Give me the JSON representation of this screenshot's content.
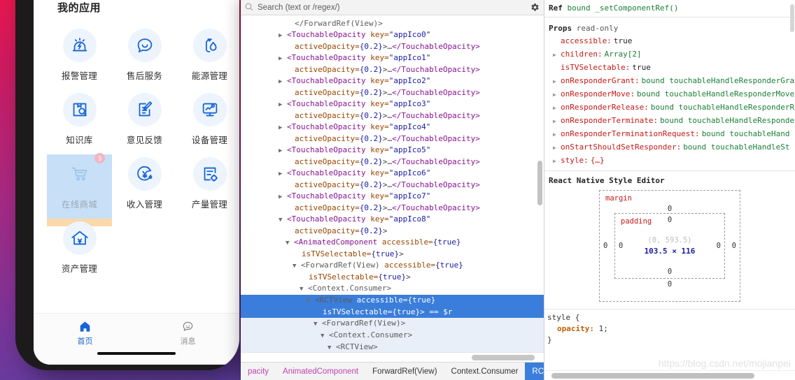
{
  "phone": {
    "section_title": "我的应用",
    "apps": [
      {
        "label": "报警管理",
        "icon": "alarm-icon",
        "selected": false,
        "badge": null
      },
      {
        "label": "售后服务",
        "icon": "chat-smile-icon",
        "selected": false,
        "badge": null
      },
      {
        "label": "能源管理",
        "icon": "energy-drop-icon",
        "selected": false,
        "badge": null
      },
      {
        "label": "知识库",
        "icon": "knowledge-search-icon",
        "selected": false,
        "badge": null
      },
      {
        "label": "意见反馈",
        "icon": "feedback-edit-icon",
        "selected": false,
        "badge": null
      },
      {
        "label": "设备管理",
        "icon": "device-monitor-icon",
        "selected": false,
        "badge": null
      },
      {
        "label": "在线商城",
        "icon": "shopping-cart-icon",
        "selected": true,
        "badge": "3"
      },
      {
        "label": "收入管理",
        "icon": "income-yuan-icon",
        "selected": false,
        "badge": null
      },
      {
        "label": "产量管理",
        "icon": "output-settings-icon",
        "selected": false,
        "badge": null
      },
      {
        "label": "资产管理",
        "icon": "asset-house-yuan-icon",
        "selected": false,
        "badge": null
      }
    ],
    "tabs": [
      {
        "label": "首页",
        "icon": "home-icon",
        "active": true
      },
      {
        "label": "消息",
        "icon": "message-icon",
        "active": false
      }
    ]
  },
  "devtools": {
    "search": {
      "placeholder": "Search (text or /regex/)",
      "value": "",
      "icon": "search-icon",
      "settings_icon": "gear-icon"
    },
    "tree_lines": [
      {
        "indent": 6,
        "arrow": "",
        "segments": [
          {
            "t": "</ForwardRef(View)>",
            "c": "tg2"
          }
        ]
      },
      {
        "indent": 5,
        "arrow": "collapsed",
        "segments": [
          {
            "t": "<TouchableOpacity ",
            "c": "tg"
          },
          {
            "t": "key=",
            "c": "attr"
          },
          {
            "t": "\"appIco0\"",
            "c": "val"
          }
        ]
      },
      {
        "indent": 6,
        "arrow": "",
        "segments": [
          {
            "t": "activeOpacity=",
            "c": "attr"
          },
          {
            "t": "{0.2}",
            "c": "val"
          },
          {
            "t": ">…",
            "c": "punc"
          },
          {
            "t": "</TouchableOpacity>",
            "c": "tg"
          }
        ]
      },
      {
        "indent": 5,
        "arrow": "collapsed",
        "segments": [
          {
            "t": "<TouchableOpacity ",
            "c": "tg"
          },
          {
            "t": "key=",
            "c": "attr"
          },
          {
            "t": "\"appIco1\"",
            "c": "val"
          }
        ]
      },
      {
        "indent": 6,
        "arrow": "",
        "segments": [
          {
            "t": "activeOpacity=",
            "c": "attr"
          },
          {
            "t": "{0.2}",
            "c": "val"
          },
          {
            "t": ">…",
            "c": "punc"
          },
          {
            "t": "</TouchableOpacity>",
            "c": "tg"
          }
        ]
      },
      {
        "indent": 5,
        "arrow": "collapsed",
        "segments": [
          {
            "t": "<TouchableOpacity ",
            "c": "tg"
          },
          {
            "t": "key=",
            "c": "attr"
          },
          {
            "t": "\"appIco2\"",
            "c": "val"
          }
        ]
      },
      {
        "indent": 6,
        "arrow": "",
        "segments": [
          {
            "t": "activeOpacity=",
            "c": "attr"
          },
          {
            "t": "{0.2}",
            "c": "val"
          },
          {
            "t": ">…",
            "c": "punc"
          },
          {
            "t": "</TouchableOpacity>",
            "c": "tg"
          }
        ]
      },
      {
        "indent": 5,
        "arrow": "collapsed",
        "segments": [
          {
            "t": "<TouchableOpacity ",
            "c": "tg"
          },
          {
            "t": "key=",
            "c": "attr"
          },
          {
            "t": "\"appIco3\"",
            "c": "val"
          }
        ]
      },
      {
        "indent": 6,
        "arrow": "",
        "segments": [
          {
            "t": "activeOpacity=",
            "c": "attr"
          },
          {
            "t": "{0.2}",
            "c": "val"
          },
          {
            "t": ">…",
            "c": "punc"
          },
          {
            "t": "</TouchableOpacity>",
            "c": "tg"
          }
        ]
      },
      {
        "indent": 5,
        "arrow": "collapsed",
        "segments": [
          {
            "t": "<TouchableOpacity ",
            "c": "tg"
          },
          {
            "t": "key=",
            "c": "attr"
          },
          {
            "t": "\"appIco4\"",
            "c": "val"
          }
        ]
      },
      {
        "indent": 6,
        "arrow": "",
        "segments": [
          {
            "t": "activeOpacity=",
            "c": "attr"
          },
          {
            "t": "{0.2}",
            "c": "val"
          },
          {
            "t": ">…",
            "c": "punc"
          },
          {
            "t": "</TouchableOpacity>",
            "c": "tg"
          }
        ]
      },
      {
        "indent": 5,
        "arrow": "collapsed",
        "segments": [
          {
            "t": "<TouchableOpacity ",
            "c": "tg"
          },
          {
            "t": "key=",
            "c": "attr"
          },
          {
            "t": "\"appIco5\"",
            "c": "val"
          }
        ]
      },
      {
        "indent": 6,
        "arrow": "",
        "segments": [
          {
            "t": "activeOpacity=",
            "c": "attr"
          },
          {
            "t": "{0.2}",
            "c": "val"
          },
          {
            "t": ">…",
            "c": "punc"
          },
          {
            "t": "</TouchableOpacity>",
            "c": "tg"
          }
        ]
      },
      {
        "indent": 5,
        "arrow": "collapsed",
        "segments": [
          {
            "t": "<TouchableOpacity ",
            "c": "tg"
          },
          {
            "t": "key=",
            "c": "attr"
          },
          {
            "t": "\"appIco6\"",
            "c": "val"
          }
        ]
      },
      {
        "indent": 6,
        "arrow": "",
        "segments": [
          {
            "t": "activeOpacity=",
            "c": "attr"
          },
          {
            "t": "{0.2}",
            "c": "val"
          },
          {
            "t": ">…",
            "c": "punc"
          },
          {
            "t": "</TouchableOpacity>",
            "c": "tg"
          }
        ]
      },
      {
        "indent": 5,
        "arrow": "collapsed",
        "segments": [
          {
            "t": "<TouchableOpacity ",
            "c": "tg"
          },
          {
            "t": "key=",
            "c": "attr"
          },
          {
            "t": "\"appIco7\"",
            "c": "val"
          }
        ]
      },
      {
        "indent": 6,
        "arrow": "",
        "segments": [
          {
            "t": "activeOpacity=",
            "c": "attr"
          },
          {
            "t": "{0.2}",
            "c": "val"
          },
          {
            "t": ">…",
            "c": "punc"
          },
          {
            "t": "</TouchableOpacity>",
            "c": "tg"
          }
        ]
      },
      {
        "indent": 5,
        "arrow": "expanded",
        "segments": [
          {
            "t": "<TouchableOpacity ",
            "c": "tg"
          },
          {
            "t": "key=",
            "c": "attr"
          },
          {
            "t": "\"appIco8\"",
            "c": "val"
          }
        ]
      },
      {
        "indent": 6,
        "arrow": "",
        "segments": [
          {
            "t": "activeOpacity=",
            "c": "attr"
          },
          {
            "t": "{0.2}",
            "c": "val"
          },
          {
            "t": ">",
            "c": "punc"
          }
        ]
      },
      {
        "indent": 6,
        "arrow": "expanded",
        "segments": [
          {
            "t": "<AnimatedComponent ",
            "c": "tg"
          },
          {
            "t": "accessible=",
            "c": "attr"
          },
          {
            "t": "{true}",
            "c": "val"
          }
        ]
      },
      {
        "indent": 7,
        "arrow": "",
        "segments": [
          {
            "t": "isTVSelectable=",
            "c": "attr"
          },
          {
            "t": "{true}",
            "c": "val"
          },
          {
            "t": ">",
            "c": "punc"
          }
        ]
      },
      {
        "indent": 7,
        "arrow": "expanded",
        "segments": [
          {
            "t": "<ForwardRef(View) ",
            "c": "tg2"
          },
          {
            "t": "accessible=",
            "c": "attr"
          },
          {
            "t": "{true}",
            "c": "val"
          }
        ]
      },
      {
        "indent": 8,
        "arrow": "",
        "segments": [
          {
            "t": "isTVSelectable=",
            "c": "attr"
          },
          {
            "t": "{true}",
            "c": "val"
          },
          {
            "t": ">",
            "c": "punc"
          }
        ]
      },
      {
        "indent": 8,
        "arrow": "expanded",
        "segments": [
          {
            "t": "<Context.Consumer>",
            "c": "tg2"
          }
        ]
      },
      {
        "indent": 9,
        "arrow": "expanded",
        "selected": true,
        "segments": [
          {
            "t": "<RCTView ",
            "c": "tg2"
          },
          {
            "t": "accessible=",
            "c": "attr"
          },
          {
            "t": "{true}",
            "c": "val"
          }
        ]
      },
      {
        "indent": 10,
        "arrow": "",
        "selected": true,
        "segments": [
          {
            "t": "isTVSelectable=",
            "c": "attr"
          },
          {
            "t": "{true}",
            "c": "val"
          },
          {
            "t": "> == $r",
            "c": "punc"
          }
        ]
      },
      {
        "indent": 10,
        "arrow": "expanded",
        "selchild": true,
        "segments": [
          {
            "t": "<ForwardRef(View)>",
            "c": "tg2"
          }
        ]
      },
      {
        "indent": 11,
        "arrow": "expanded",
        "selchild": true,
        "segments": [
          {
            "t": "<Context.Consumer>",
            "c": "tg2"
          }
        ]
      },
      {
        "indent": 12,
        "arrow": "expanded",
        "selchild": true,
        "segments": [
          {
            "t": "<RCTView>",
            "c": "tg2"
          }
        ]
      }
    ],
    "breadcrumb": [
      {
        "label": "pacity",
        "type": "component",
        "active": false
      },
      {
        "label": "AnimatedComponent",
        "type": "component",
        "active": false
      },
      {
        "label": "ForwardRef(View)",
        "type": "host",
        "active": false
      },
      {
        "label": "Context.Consumer",
        "type": "host",
        "active": false
      },
      {
        "label": "RCTView",
        "type": "host",
        "active": true
      }
    ],
    "ref_section": {
      "title": "Ref",
      "value": "bound _setComponentRef()"
    },
    "props_section": {
      "title": "Props",
      "subtitle": "read-only",
      "rows": [
        {
          "key": "accessible",
          "value": "true",
          "kind": "bool",
          "expandable": false
        },
        {
          "key": "children",
          "value": "Array[2]",
          "kind": "arr",
          "expandable": true
        },
        {
          "key": "isTVSelectable",
          "value": "true",
          "kind": "bool",
          "expandable": false
        },
        {
          "key": "onResponderGrant",
          "value": "bound touchableHandleResponderGra",
          "kind": "str",
          "expandable": true
        },
        {
          "key": "onResponderMove",
          "value": "bound touchableHandleResponderMove",
          "kind": "str",
          "expandable": true
        },
        {
          "key": "onResponderRelease",
          "value": "bound touchableHandleResponderR",
          "kind": "str",
          "expandable": true
        },
        {
          "key": "onResponderTerminate",
          "value": "bound touchableHandleResponde",
          "kind": "str",
          "expandable": true
        },
        {
          "key": "onResponderTerminationRequest",
          "value": "bound touchableHand",
          "kind": "str",
          "expandable": true
        },
        {
          "key": "onStartShouldSetResponder",
          "value": "bound touchableHandleSt",
          "kind": "str",
          "expandable": true
        },
        {
          "key": "style",
          "value": "{…}",
          "kind": "obj",
          "expandable": true
        }
      ]
    },
    "style_editor": {
      "title": "React Native Style Editor",
      "margin_label": "margin",
      "padding_label": "padding",
      "margin_top": "0",
      "margin_right": "0",
      "margin_bottom": "0",
      "margin_left": "0",
      "padding_top": "0",
      "padding_right": "0",
      "padding_bottom": "0",
      "padding_left": "0",
      "coords": "(0, 593.5)",
      "size": "103.5 × 116"
    },
    "style_text": {
      "open": "style {",
      "prop": "opacity:",
      "val": "1;",
      "close": "}"
    },
    "watermark": "https://blog.csdn.net/mojianpei"
  },
  "colors": {
    "accent_blue": "#1565d8",
    "selection_blue": "#3a7ddb",
    "highlight_bg": "#c7e0f8",
    "margin_orange": "#fbd9ab",
    "tag_purple": "#881391",
    "attr_orange": "#994500",
    "value_blue": "#1a1aa6",
    "prop_red": "#c41a16",
    "prop_green": "#1a7f37"
  }
}
